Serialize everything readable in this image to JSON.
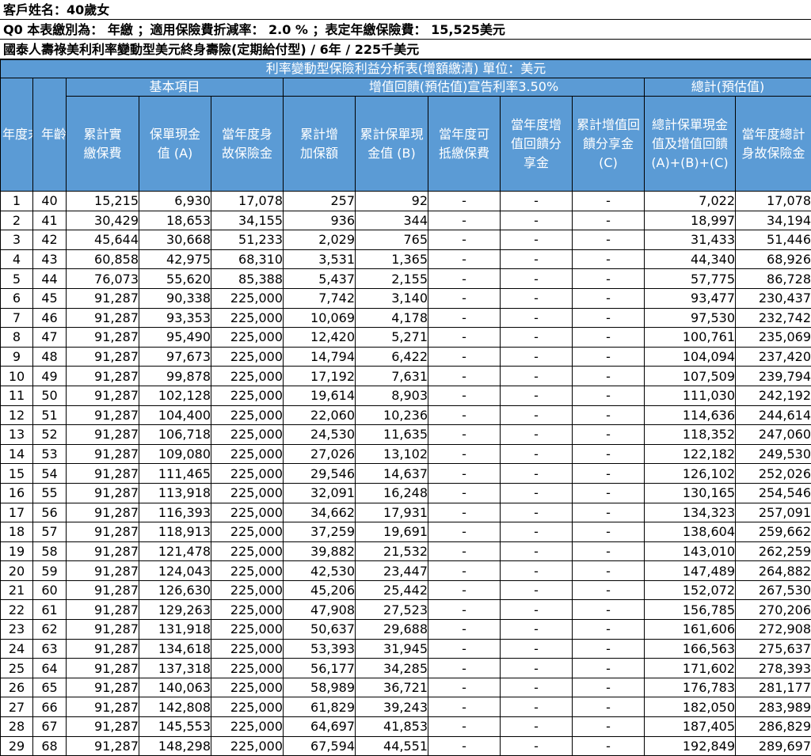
{
  "header": {
    "customer": "客戶姓名：40歲女",
    "payment": "Q0 本表繳別為： 年繳 ；適用保險費折減率： 2.0 % ；表定年繳保險費： 15,525美元",
    "product": "國泰人壽祿美利利率變動型美元終身壽險(定期給付型) / 6年 / 225千美元"
  },
  "table": {
    "title": "利率變動型保險利益分析表(增額繳清) 單位：美元",
    "groups": {
      "basic": "基本項目",
      "increase": "增值回饋(預估值)宣告利率3.50%",
      "total": "總計(預估值)"
    },
    "columns": {
      "year": "年度末",
      "age": "年齡",
      "cum_premium": "累計實繳保費",
      "cash_value": "保單現金值 (A)",
      "death_benefit": "當年度身故保險金",
      "cum_increase": "累計增加保額",
      "cum_cash_b": "累計保單現金值 (B)",
      "deductible": "當年度可抵繳保費",
      "year_share": "當年度增值回饋分享金",
      "cum_share": "累計增值回饋分享金 (C)",
      "total_value": "總計保單現金值及增值回饋 (A)+(B)+(C)",
      "total_death": "當年度總計身故保險金"
    },
    "rows": [
      [
        "1",
        "40",
        "15,215",
        "6,930",
        "17,078",
        "257",
        "92",
        "-",
        "-",
        "-",
        "7,022",
        "17,078"
      ],
      [
        "2",
        "41",
        "30,429",
        "18,653",
        "34,155",
        "936",
        "344",
        "-",
        "-",
        "-",
        "18,997",
        "34,194"
      ],
      [
        "3",
        "42",
        "45,644",
        "30,668",
        "51,233",
        "2,029",
        "765",
        "-",
        "-",
        "-",
        "31,433",
        "51,446"
      ],
      [
        "4",
        "43",
        "60,858",
        "42,975",
        "68,310",
        "3,531",
        "1,365",
        "-",
        "-",
        "-",
        "44,340",
        "68,926"
      ],
      [
        "5",
        "44",
        "76,073",
        "55,620",
        "85,388",
        "5,437",
        "2,155",
        "-",
        "-",
        "-",
        "57,775",
        "86,728"
      ],
      [
        "6",
        "45",
        "91,287",
        "90,338",
        "225,000",
        "7,742",
        "3,140",
        "-",
        "-",
        "-",
        "93,477",
        "230,437"
      ],
      [
        "7",
        "46",
        "91,287",
        "93,353",
        "225,000",
        "10,069",
        "4,178",
        "-",
        "-",
        "-",
        "97,530",
        "232,742"
      ],
      [
        "8",
        "47",
        "91,287",
        "95,490",
        "225,000",
        "12,420",
        "5,271",
        "-",
        "-",
        "-",
        "100,761",
        "235,069"
      ],
      [
        "9",
        "48",
        "91,287",
        "97,673",
        "225,000",
        "14,794",
        "6,422",
        "-",
        "-",
        "-",
        "104,094",
        "237,420"
      ],
      [
        "10",
        "49",
        "91,287",
        "99,878",
        "225,000",
        "17,192",
        "7,631",
        "-",
        "-",
        "-",
        "107,509",
        "239,794"
      ],
      [
        "11",
        "50",
        "91,287",
        "102,128",
        "225,000",
        "19,614",
        "8,903",
        "-",
        "-",
        "-",
        "111,030",
        "242,192"
      ],
      [
        "12",
        "51",
        "91,287",
        "104,400",
        "225,000",
        "22,060",
        "10,236",
        "-",
        "-",
        "-",
        "114,636",
        "244,614"
      ],
      [
        "13",
        "52",
        "91,287",
        "106,718",
        "225,000",
        "24,530",
        "11,635",
        "-",
        "-",
        "-",
        "118,352",
        "247,060"
      ],
      [
        "14",
        "53",
        "91,287",
        "109,080",
        "225,000",
        "27,026",
        "13,102",
        "-",
        "-",
        "-",
        "122,182",
        "249,530"
      ],
      [
        "15",
        "54",
        "91,287",
        "111,465",
        "225,000",
        "29,546",
        "14,637",
        "-",
        "-",
        "-",
        "126,102",
        "252,026"
      ],
      [
        "16",
        "55",
        "91,287",
        "113,918",
        "225,000",
        "32,091",
        "16,248",
        "-",
        "-",
        "-",
        "130,165",
        "254,546"
      ],
      [
        "17",
        "56",
        "91,287",
        "116,393",
        "225,000",
        "34,662",
        "17,931",
        "-",
        "-",
        "-",
        "134,323",
        "257,091"
      ],
      [
        "18",
        "57",
        "91,287",
        "118,913",
        "225,000",
        "37,259",
        "19,691",
        "-",
        "-",
        "-",
        "138,604",
        "259,662"
      ],
      [
        "19",
        "58",
        "91,287",
        "121,478",
        "225,000",
        "39,882",
        "21,532",
        "-",
        "-",
        "-",
        "143,010",
        "262,259"
      ],
      [
        "20",
        "59",
        "91,287",
        "124,043",
        "225,000",
        "42,530",
        "23,447",
        "-",
        "-",
        "-",
        "147,489",
        "264,882"
      ],
      [
        "21",
        "60",
        "91,287",
        "126,630",
        "225,000",
        "45,206",
        "25,442",
        "-",
        "-",
        "-",
        "152,072",
        "267,530"
      ],
      [
        "22",
        "61",
        "91,287",
        "129,263",
        "225,000",
        "47,908",
        "27,523",
        "-",
        "-",
        "-",
        "156,785",
        "270,206"
      ],
      [
        "23",
        "62",
        "91,287",
        "131,918",
        "225,000",
        "50,637",
        "29,688",
        "-",
        "-",
        "-",
        "161,606",
        "272,908"
      ],
      [
        "24",
        "63",
        "91,287",
        "134,618",
        "225,000",
        "53,393",
        "31,945",
        "-",
        "-",
        "-",
        "166,563",
        "275,637"
      ],
      [
        "25",
        "64",
        "91,287",
        "137,318",
        "225,000",
        "56,177",
        "34,285",
        "-",
        "-",
        "-",
        "171,602",
        "278,393"
      ],
      [
        "26",
        "65",
        "91,287",
        "140,063",
        "225,000",
        "58,989",
        "36,721",
        "-",
        "-",
        "-",
        "176,783",
        "281,177"
      ],
      [
        "27",
        "66",
        "91,287",
        "142,808",
        "225,000",
        "61,829",
        "39,243",
        "-",
        "-",
        "-",
        "182,050",
        "283,989"
      ],
      [
        "28",
        "67",
        "91,287",
        "145,553",
        "225,000",
        "64,697",
        "41,853",
        "-",
        "-",
        "-",
        "187,405",
        "286,829"
      ],
      [
        "29",
        "68",
        "91,287",
        "148,298",
        "225,000",
        "67,594",
        "44,551",
        "-",
        "-",
        "-",
        "192,849",
        "289,697"
      ]
    ]
  }
}
